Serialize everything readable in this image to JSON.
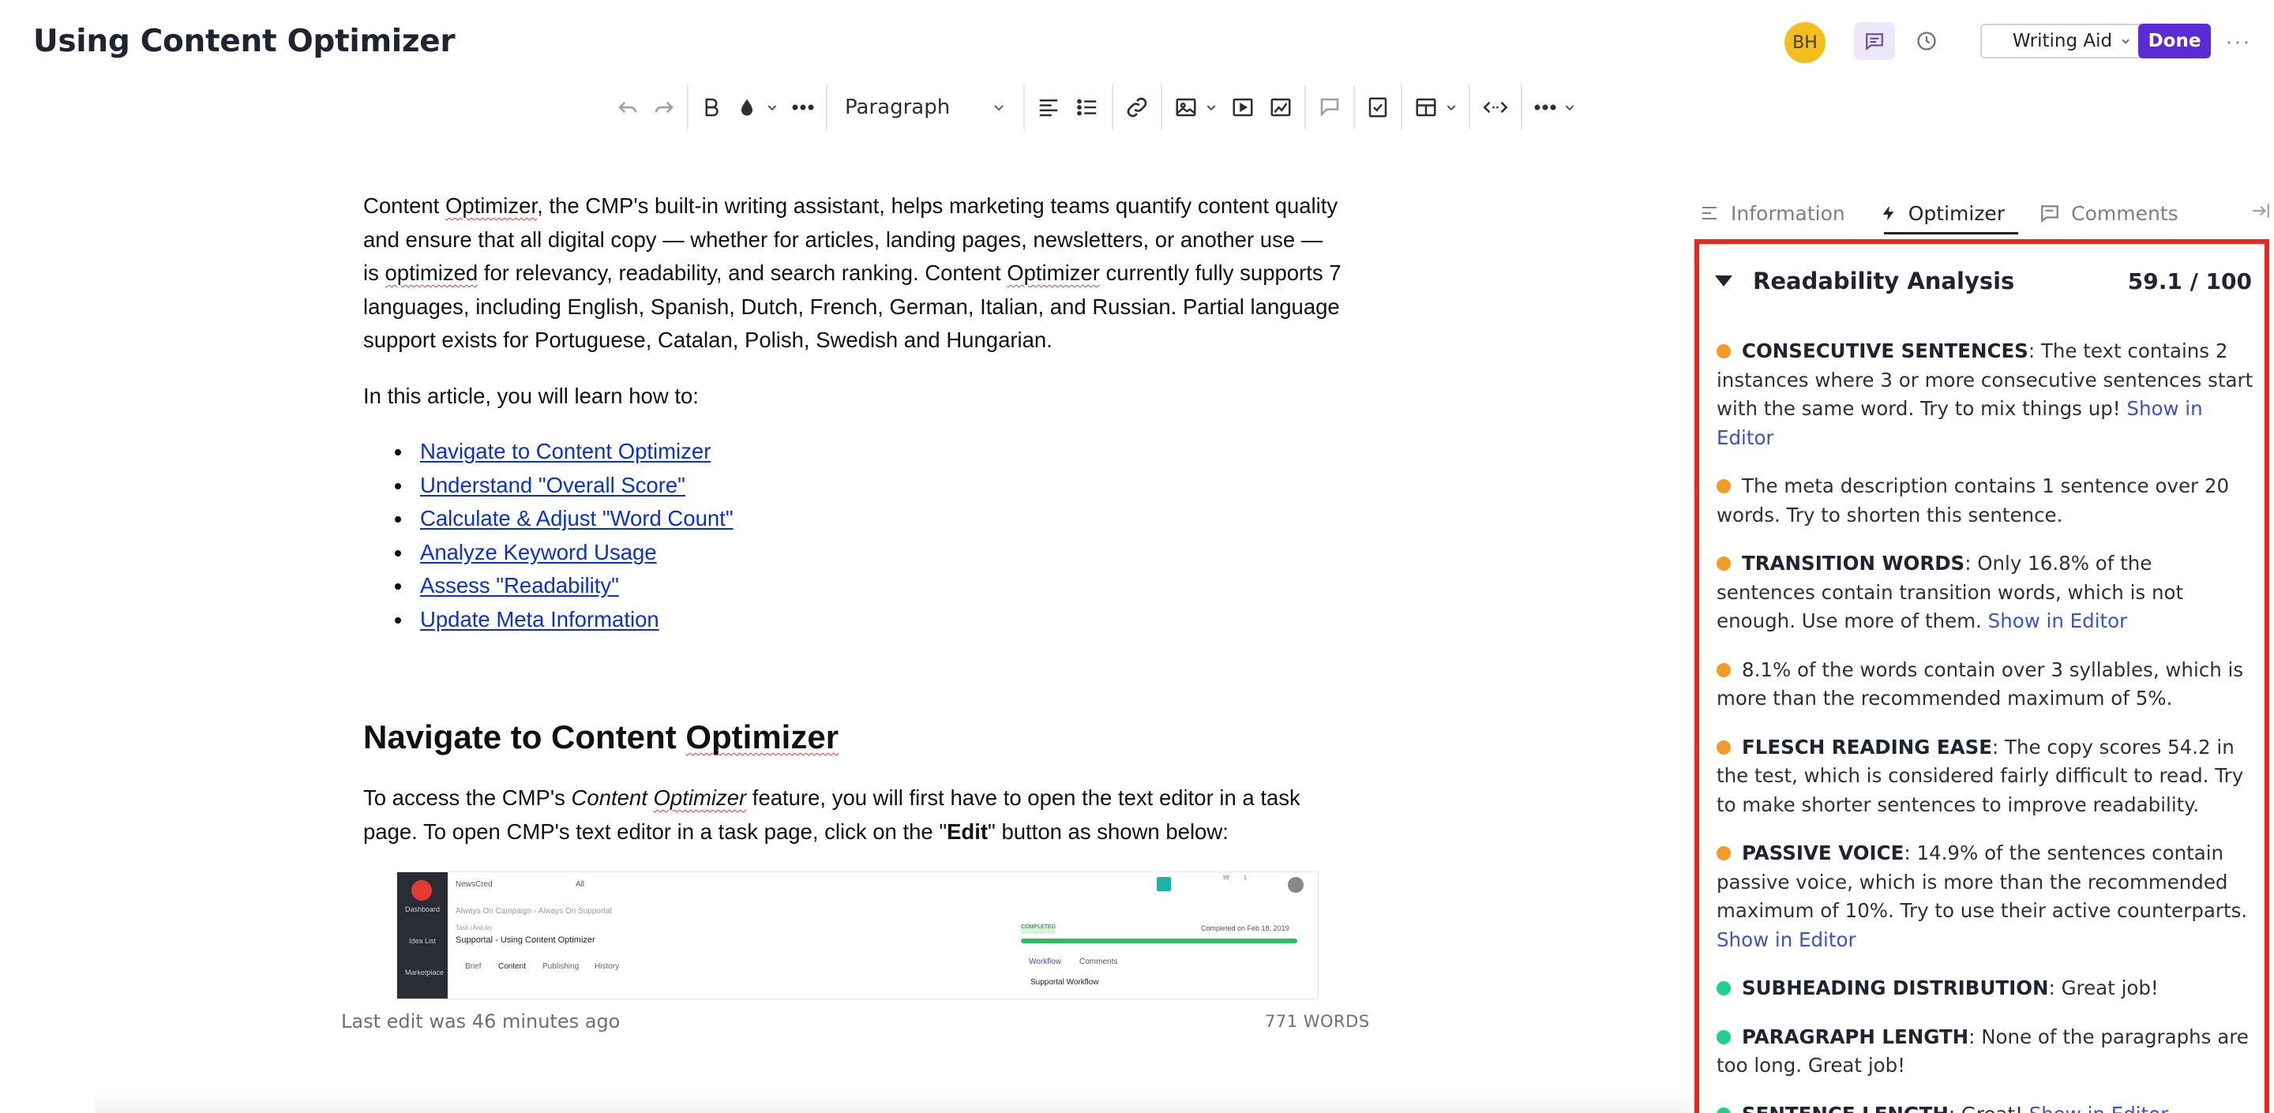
{
  "header": {
    "title": "Using Content Optimizer",
    "avatar_initials": "BH",
    "writing_aid_label": "Writing Aid",
    "done_label": "Done",
    "more_label": "···"
  },
  "toolbar": {
    "paragraph_select": "Paragraph"
  },
  "document": {
    "intro_p1": "Content ",
    "intro_sq1": "Optimizer",
    "intro_p2": ", the CMP's built-in writing assistant, helps marketing teams quantify content quality and ensure that all digital copy — whether for articles, landing pages, newsletters, or another use — is ",
    "intro_sq2": "optimized",
    "intro_p3": " for relevancy, readability, and search ranking. Content ",
    "intro_sq3": "Optimizer",
    "intro_p4": " currently fully supports 7 languages, including English, Spanish, Dutch, French, German, Italian, and Russian. Partial language support exists for Portuguese, Catalan, Polish, Swedish and Hungarian.",
    "learn_intro": "In this article, you will learn how to:",
    "links": [
      "Navigate to Content Optimizer",
      "Understand \"Overall Score\"",
      "Calculate & Adjust \"Word Count\"",
      "Analyze Keyword Usage",
      "Assess \"Readability\"",
      "Update Meta Information"
    ],
    "section_heading_a": "Navigate to Content ",
    "section_heading_sq": "Optimizer",
    "access_p1": "To access the CMP's ",
    "access_em": "Content ",
    "access_em_sq": "Optimizer",
    "access_p2": " feature, you will first have to open the text editor in a task page. To open CMP's text editor in a task page, click on the \"",
    "access_bold": "Edit",
    "access_p3": "\" button as shown below:"
  },
  "embedded_screenshot": {
    "nav": [
      "Dashboard",
      "Idea List",
      "Marketplace"
    ],
    "topbar_org": "NewsCred",
    "topbar_filter": "All",
    "breadcrumb": "Always On Campaign › Always On Supportal",
    "label_task": "Task (Article)",
    "task_title": "Supportal - Using Content Optimizer",
    "tabs": [
      "Brief",
      "Content",
      "Publishing",
      "History"
    ],
    "status_badge": "COMPLETED",
    "completed_text": "Completed on Feb 18, 2019",
    "workflow_tabs": [
      "Workflow",
      "Comments"
    ],
    "workflow_label": "Supportal Workflow",
    "notif_count_1": "99",
    "notif_count_2": "1"
  },
  "footer": {
    "last_edit": "Last edit was 46 minutes ago",
    "word_count": "771 WORDS"
  },
  "right_panel": {
    "tabs": [
      "Information",
      "Optimizer",
      "Comments"
    ],
    "active_tab": "Optimizer",
    "section_title": "Readability Analysis",
    "score": "59.1 / 100",
    "show_in_editor": "Show in Editor",
    "items": [
      {
        "status": "orange",
        "label": "CONSECUTIVE SENTENCES",
        "text": ": The text contains 2 instances where 3 or more consecutive sentences start with the same word. Try to mix things up! ",
        "link": "Show in Editor"
      },
      {
        "status": "orange",
        "label": "",
        "text": "The meta description contains 1 sentence over 20 words. Try to shorten this sentence.",
        "link": ""
      },
      {
        "status": "orange",
        "label": "TRANSITION WORDS",
        "text": ": Only 16.8% of the sentences contain transition words, which is not enough. Use more of them. ",
        "link": "Show in Editor"
      },
      {
        "status": "orange",
        "label": "",
        "text": "8.1% of the words contain over 3 syllables, which is more than the recommended maximum of 5%.",
        "link": ""
      },
      {
        "status": "orange",
        "label": "FLESCH READING EASE",
        "text": ": The copy scores 54.2 in the test, which is considered fairly difficult to read. Try to make shorter sentences to improve readability.",
        "link": ""
      },
      {
        "status": "orange",
        "label": "PASSIVE VOICE",
        "text": ": 14.9% of the sentences contain passive voice, which is more than the recommended maximum of 10%. Try to use their active counterparts. ",
        "link": "Show in Editor"
      },
      {
        "status": "green",
        "label": "SUBHEADING DISTRIBUTION",
        "text": ": Great job!",
        "link": ""
      },
      {
        "status": "green",
        "label": "PARAGRAPH LENGTH",
        "text": ": None of the paragraphs are too long. Great job!",
        "link": ""
      },
      {
        "status": "green",
        "label": "SENTENCE LENGTH",
        "text": ": Great! ",
        "link": "Show in Editor"
      }
    ]
  },
  "colors": {
    "accent": "#5b2bd6",
    "highlight_border": "#e8281e",
    "warning_dot": "#f59a27",
    "success_dot": "#1fd18b",
    "link": "#0b2fd3"
  }
}
